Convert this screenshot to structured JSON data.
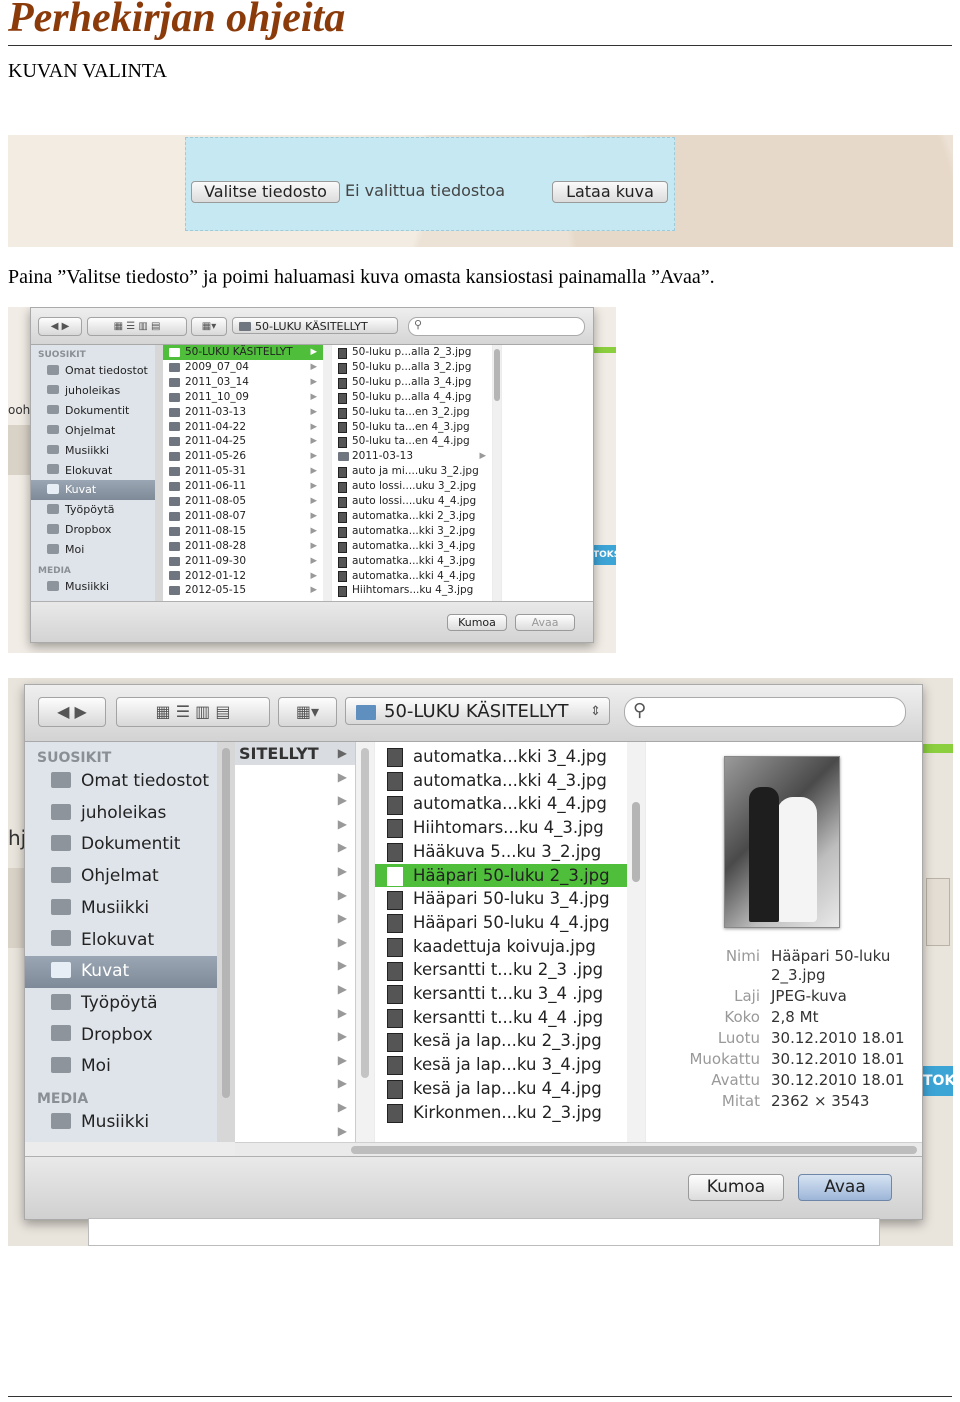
{
  "header": {
    "title": "Perhekirjan ohjeita",
    "section": "KUVAN VALINTA"
  },
  "upload": {
    "choose_label": "Valitse tiedosto",
    "no_file_label": "Ei valittua tiedostoa",
    "upload_label": "Lataa kuva"
  },
  "caption": "Paina ”Valitse tiedosto” ja poimi haluamasi kuva omasta kansiostasi painamalla ”Avaa”.",
  "dialog_small": {
    "location": "50-LUKU KÄSITELLYT",
    "sidebar": {
      "favorites_heading": "SUOSIKIT",
      "favorites": [
        "Omat tiedostot",
        "juholeikas",
        "Dokumentit",
        "Ohjelmat",
        "Musiikki",
        "Elokuvat",
        "Kuvat",
        "Työpöytä",
        "Dropbox",
        "Moi"
      ],
      "selected": "Kuvat",
      "media_heading": "MEDIA",
      "media": [
        "Musiikki"
      ]
    },
    "folders": [
      "50-LUKU KÄSITELLYT",
      "2009_07_04",
      "2011_03_14",
      "2011_10_09",
      "2011-03-13",
      "2011-04-22",
      "2011-04-25",
      "2011-05-26",
      "2011-05-31",
      "2011-06-11",
      "2011-08-05",
      "2011-08-07",
      "2011-08-15",
      "2011-08-28",
      "2011-09-30",
      "2012-01-12",
      "2012-05-15"
    ],
    "files": [
      "50-luku p...alla 2_3.jpg",
      "50-luku p...alla 3_2.jpg",
      "50-luku p...alla 3_4.jpg",
      "50-luku p...alla 4_4.jpg",
      "50-luku ta...en 3_2.jpg",
      "50-luku ta...en 4_3.jpg",
      "50-luku ta...en 4_4.jpg",
      "2011-03-13",
      "auto ja mi....uku 3_2.jpg",
      "auto lossi....uku 3_2.jpg",
      "auto lossi....uku 4_4.jpg",
      "automatka...kki 2_3.jpg",
      "automatka...kki 3_2.jpg",
      "automatka...kki 3_4.jpg",
      "automatka...kki 4_3.jpg",
      "automatka...kki 4_4.jpg",
      "Hiihtomars...ku 4_3.jpg"
    ],
    "bg_text_left": "oohj",
    "bg_text_right": "TOKS",
    "cancel_label": "Kumoa",
    "open_label": "Avaa"
  },
  "dialog_large": {
    "location": "50-LUKU KÄSITELLYT",
    "sidebar": {
      "favorites_heading": "SUOSIKIT",
      "favorites": [
        "Omat tiedostot",
        "juholeikas",
        "Dokumentit",
        "Ohjelmat",
        "Musiikki",
        "Elokuvat",
        "Kuvat",
        "Työpöytä",
        "Dropbox",
        "Moi"
      ],
      "selected": "Kuvat",
      "media_heading": "MEDIA",
      "media": [
        "Musiikki"
      ]
    },
    "folder_column_label": "SITELLYT",
    "files": [
      "automatka...kki 3_4.jpg",
      "automatka...kki 4_3.jpg",
      "automatka...kki 4_4.jpg",
      "Hiihtomars...ku 4_3.jpg",
      "Hääkuva 5...ku 3_2.jpg",
      "Hääpari 50-luku 2_3.jpg",
      "Hääpari 50-luku 3_4.jpg",
      "Hääpari 50-luku 4_4.jpg",
      "kaadettuja koivuja.jpg",
      "kersantti t...ku 2_3 .jpg",
      "kersantti t...ku 3_4 .jpg",
      "kersantti t...ku 4_4 .jpg",
      "kesä ja lap...ku 2_3.jpg",
      "kesä ja lap...ku 3_4.jpg",
      "kesä ja lap...ku 4_4.jpg",
      "Kirkonmen...ku 2_3.jpg"
    ],
    "selected_file": "Hääpari 50-luku 2_3.jpg",
    "preview": {
      "name_label": "Nimi",
      "name_value_1": "Hääpari 50-luku",
      "name_value_2": "2_3.jpg",
      "kind_label": "Laji",
      "kind_value": "JPEG-kuva",
      "size_label": "Koko",
      "size_value": "2,8 Mt",
      "created_label": "Luotu",
      "created_value": "30.12.2010 18.01",
      "modified_label": "Muokattu",
      "modified_value": "30.12.2010 18.01",
      "opened_label": "Avattu",
      "opened_value": "30.12.2010 18.01",
      "dims_label": "Mitat",
      "dims_value": "2362 × 3543"
    },
    "bg_text_left": "hj",
    "bg_text_right": "TOK",
    "cancel_label": "Kumoa",
    "open_label": "Avaa"
  }
}
